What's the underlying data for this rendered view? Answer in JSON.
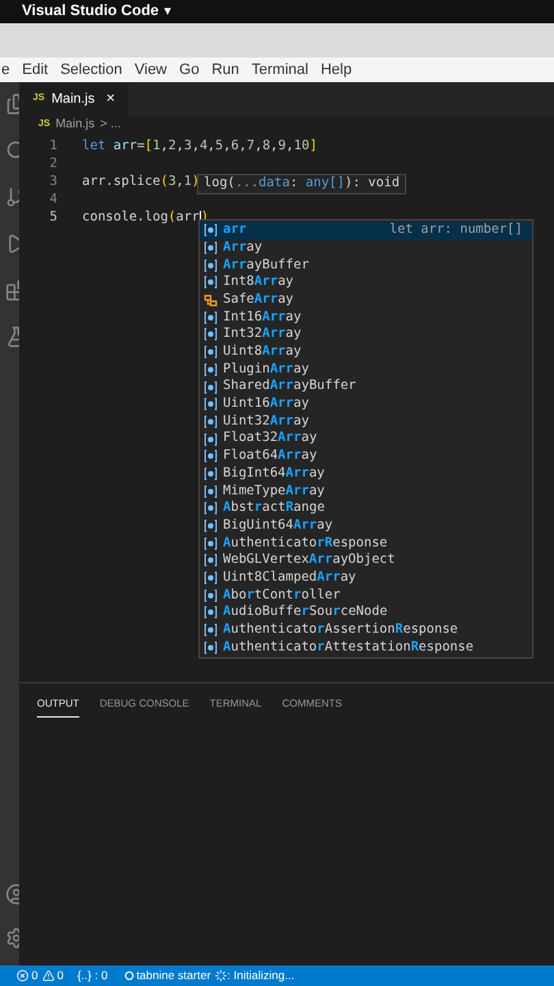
{
  "window": {
    "title": "Visual Studio Code",
    "title_caret": "▾"
  },
  "menu": [
    "e",
    "Edit",
    "Selection",
    "View",
    "Go",
    "Run",
    "Terminal",
    "Help"
  ],
  "tab": {
    "icon": "JS",
    "label": "Main.js",
    "close": "×"
  },
  "breadcrumb": {
    "icon": "JS",
    "file": "Main.js",
    "rest": "> ..."
  },
  "code": [
    {
      "number": "1",
      "active": false,
      "tokens": [
        {
          "kind": "keyword",
          "text": "let "
        },
        {
          "kind": "variable",
          "text": "arr"
        },
        {
          "kind": "plain",
          "text": "="
        },
        {
          "kind": "bracket",
          "text": "["
        },
        {
          "kind": "number",
          "text": "1"
        },
        {
          "kind": "plain",
          "text": ","
        },
        {
          "kind": "number",
          "text": "2"
        },
        {
          "kind": "plain",
          "text": ","
        },
        {
          "kind": "number",
          "text": "3"
        },
        {
          "kind": "plain",
          "text": ","
        },
        {
          "kind": "number",
          "text": "4"
        },
        {
          "kind": "plain",
          "text": ","
        },
        {
          "kind": "number",
          "text": "5"
        },
        {
          "kind": "plain",
          "text": ","
        },
        {
          "kind": "number",
          "text": "6"
        },
        {
          "kind": "plain",
          "text": ","
        },
        {
          "kind": "number",
          "text": "7"
        },
        {
          "kind": "plain",
          "text": ","
        },
        {
          "kind": "number",
          "text": "8"
        },
        {
          "kind": "plain",
          "text": ","
        },
        {
          "kind": "number",
          "text": "9"
        },
        {
          "kind": "plain",
          "text": ","
        },
        {
          "kind": "number",
          "text": "10"
        },
        {
          "kind": "bracket",
          "text": "]"
        }
      ]
    },
    {
      "number": "2",
      "active": false
    },
    {
      "number": "3",
      "active": false,
      "tokens": [
        {
          "kind": "plain",
          "text": "arr.splice"
        },
        {
          "kind": "bracket",
          "text": "("
        },
        {
          "kind": "number",
          "text": "3"
        },
        {
          "kind": "plain",
          "text": ","
        },
        {
          "kind": "number",
          "text": "1"
        },
        {
          "kind": "bracket",
          "text": ")"
        }
      ]
    },
    {
      "number": "4",
      "active": false
    },
    {
      "number": "5",
      "active": true,
      "tokens": [
        {
          "kind": "plain",
          "text": "console.log"
        },
        {
          "kind": "bracket",
          "text": "("
        },
        {
          "kind": "plain",
          "text": "arr"
        },
        {
          "kind": "cursor"
        },
        {
          "kind": "bracket",
          "text": ")"
        }
      ]
    }
  ],
  "hover": [
    {
      "kind": "plain",
      "text": "log("
    },
    {
      "kind": "keyword",
      "text": "...data"
    },
    {
      "kind": "plain",
      "text": ": "
    },
    {
      "kind": "keyword",
      "text": "any[]"
    },
    {
      "kind": "plain",
      "text": "): void"
    }
  ],
  "suggestions": [
    {
      "kind": "variable",
      "selected": true,
      "parts": [
        {
          "match": true,
          "text": "arr"
        }
      ],
      "detail": "let arr: number[]"
    },
    {
      "kind": "variable",
      "selected": false,
      "parts": [
        {
          "match": true,
          "text": "Arr"
        },
        {
          "match": false,
          "text": "ay"
        }
      ]
    },
    {
      "kind": "variable",
      "selected": false,
      "parts": [
        {
          "match": true,
          "text": "Arr"
        },
        {
          "match": false,
          "text": "ayBuffer"
        }
      ]
    },
    {
      "kind": "variable",
      "selected": false,
      "parts": [
        {
          "match": false,
          "text": "Int8"
        },
        {
          "match": true,
          "text": "Arr"
        },
        {
          "match": false,
          "text": "ay"
        }
      ]
    },
    {
      "kind": "class",
      "selected": false,
      "parts": [
        {
          "match": false,
          "text": "Safe"
        },
        {
          "match": true,
          "text": "Arr"
        },
        {
          "match": false,
          "text": "ay"
        }
      ]
    },
    {
      "kind": "variable",
      "selected": false,
      "parts": [
        {
          "match": false,
          "text": "Int16"
        },
        {
          "match": true,
          "text": "Arr"
        },
        {
          "match": false,
          "text": "ay"
        }
      ]
    },
    {
      "kind": "variable",
      "selected": false,
      "parts": [
        {
          "match": false,
          "text": "Int32"
        },
        {
          "match": true,
          "text": "Arr"
        },
        {
          "match": false,
          "text": "ay"
        }
      ]
    },
    {
      "kind": "variable",
      "selected": false,
      "parts": [
        {
          "match": false,
          "text": "Uint8"
        },
        {
          "match": true,
          "text": "Arr"
        },
        {
          "match": false,
          "text": "ay"
        }
      ]
    },
    {
      "kind": "variable",
      "selected": false,
      "parts": [
        {
          "match": false,
          "text": "Plugin"
        },
        {
          "match": true,
          "text": "Arr"
        },
        {
          "match": false,
          "text": "ay"
        }
      ]
    },
    {
      "kind": "variable",
      "selected": false,
      "parts": [
        {
          "match": false,
          "text": "Shared"
        },
        {
          "match": true,
          "text": "Arr"
        },
        {
          "match": false,
          "text": "ayBuffer"
        }
      ]
    },
    {
      "kind": "variable",
      "selected": false,
      "parts": [
        {
          "match": false,
          "text": "Uint16"
        },
        {
          "match": true,
          "text": "Arr"
        },
        {
          "match": false,
          "text": "ay"
        }
      ]
    },
    {
      "kind": "variable",
      "selected": false,
      "parts": [
        {
          "match": false,
          "text": "Uint32"
        },
        {
          "match": true,
          "text": "Arr"
        },
        {
          "match": false,
          "text": "ay"
        }
      ]
    },
    {
      "kind": "variable",
      "selected": false,
      "parts": [
        {
          "match": false,
          "text": "Float32"
        },
        {
          "match": true,
          "text": "Arr"
        },
        {
          "match": false,
          "text": "ay"
        }
      ]
    },
    {
      "kind": "variable",
      "selected": false,
      "parts": [
        {
          "match": false,
          "text": "Float64"
        },
        {
          "match": true,
          "text": "Arr"
        },
        {
          "match": false,
          "text": "ay"
        }
      ]
    },
    {
      "kind": "variable",
      "selected": false,
      "parts": [
        {
          "match": false,
          "text": "BigInt64"
        },
        {
          "match": true,
          "text": "Arr"
        },
        {
          "match": false,
          "text": "ay"
        }
      ]
    },
    {
      "kind": "variable",
      "selected": false,
      "parts": [
        {
          "match": false,
          "text": "MimeType"
        },
        {
          "match": true,
          "text": "Arr"
        },
        {
          "match": false,
          "text": "ay"
        }
      ]
    },
    {
      "kind": "variable",
      "selected": false,
      "parts": [
        {
          "match": true,
          "text": "A"
        },
        {
          "match": false,
          "text": "bst"
        },
        {
          "match": true,
          "text": "r"
        },
        {
          "match": false,
          "text": "act"
        },
        {
          "match": true,
          "text": "R"
        },
        {
          "match": false,
          "text": "ange"
        }
      ]
    },
    {
      "kind": "variable",
      "selected": false,
      "parts": [
        {
          "match": false,
          "text": "BigUint64"
        },
        {
          "match": true,
          "text": "Arr"
        },
        {
          "match": false,
          "text": "ay"
        }
      ]
    },
    {
      "kind": "variable",
      "selected": false,
      "parts": [
        {
          "match": true,
          "text": "A"
        },
        {
          "match": false,
          "text": "uthenticato"
        },
        {
          "match": true,
          "text": "rR"
        },
        {
          "match": false,
          "text": "esponse"
        }
      ]
    },
    {
      "kind": "variable",
      "selected": false,
      "parts": [
        {
          "match": false,
          "text": "WebGLVertex"
        },
        {
          "match": true,
          "text": "Arr"
        },
        {
          "match": false,
          "text": "ayObject"
        }
      ]
    },
    {
      "kind": "variable",
      "selected": false,
      "parts": [
        {
          "match": false,
          "text": "Uint8Clamped"
        },
        {
          "match": true,
          "text": "Arr"
        },
        {
          "match": false,
          "text": "ay"
        }
      ]
    },
    {
      "kind": "variable",
      "selected": false,
      "parts": [
        {
          "match": true,
          "text": "A"
        },
        {
          "match": false,
          "text": "bo"
        },
        {
          "match": true,
          "text": "r"
        },
        {
          "match": false,
          "text": "tCont"
        },
        {
          "match": true,
          "text": "r"
        },
        {
          "match": false,
          "text": "oller"
        }
      ]
    },
    {
      "kind": "variable",
      "selected": false,
      "parts": [
        {
          "match": true,
          "text": "A"
        },
        {
          "match": false,
          "text": "udioBuffe"
        },
        {
          "match": true,
          "text": "r"
        },
        {
          "match": false,
          "text": "Sou"
        },
        {
          "match": true,
          "text": "r"
        },
        {
          "match": false,
          "text": "ceNode"
        }
      ]
    },
    {
      "kind": "variable",
      "selected": false,
      "parts": [
        {
          "match": true,
          "text": "A"
        },
        {
          "match": false,
          "text": "uthenticato"
        },
        {
          "match": true,
          "text": "r"
        },
        {
          "match": false,
          "text": "Assertion"
        },
        {
          "match": true,
          "text": "R"
        },
        {
          "match": false,
          "text": "esponse"
        }
      ]
    },
    {
      "kind": "variable",
      "selected": false,
      "parts": [
        {
          "match": true,
          "text": "A"
        },
        {
          "match": false,
          "text": "uthenticato"
        },
        {
          "match": true,
          "text": "r"
        },
        {
          "match": false,
          "text": "Attestation"
        },
        {
          "match": true,
          "text": "R"
        },
        {
          "match": false,
          "text": "esponse"
        }
      ]
    }
  ],
  "panel_tabs": [
    {
      "label": "OUTPUT",
      "selected": true
    },
    {
      "label": "DEBUG CONSOLE",
      "selected": false
    },
    {
      "label": "TERMINAL",
      "selected": false
    },
    {
      "label": "COMMENTS",
      "selected": false
    }
  ],
  "status_bar": {
    "errors": "0",
    "warnings": "0",
    "brackets": "{..} : 0",
    "tabnine": "tabnine starter",
    "progress": ": Initializing..."
  }
}
